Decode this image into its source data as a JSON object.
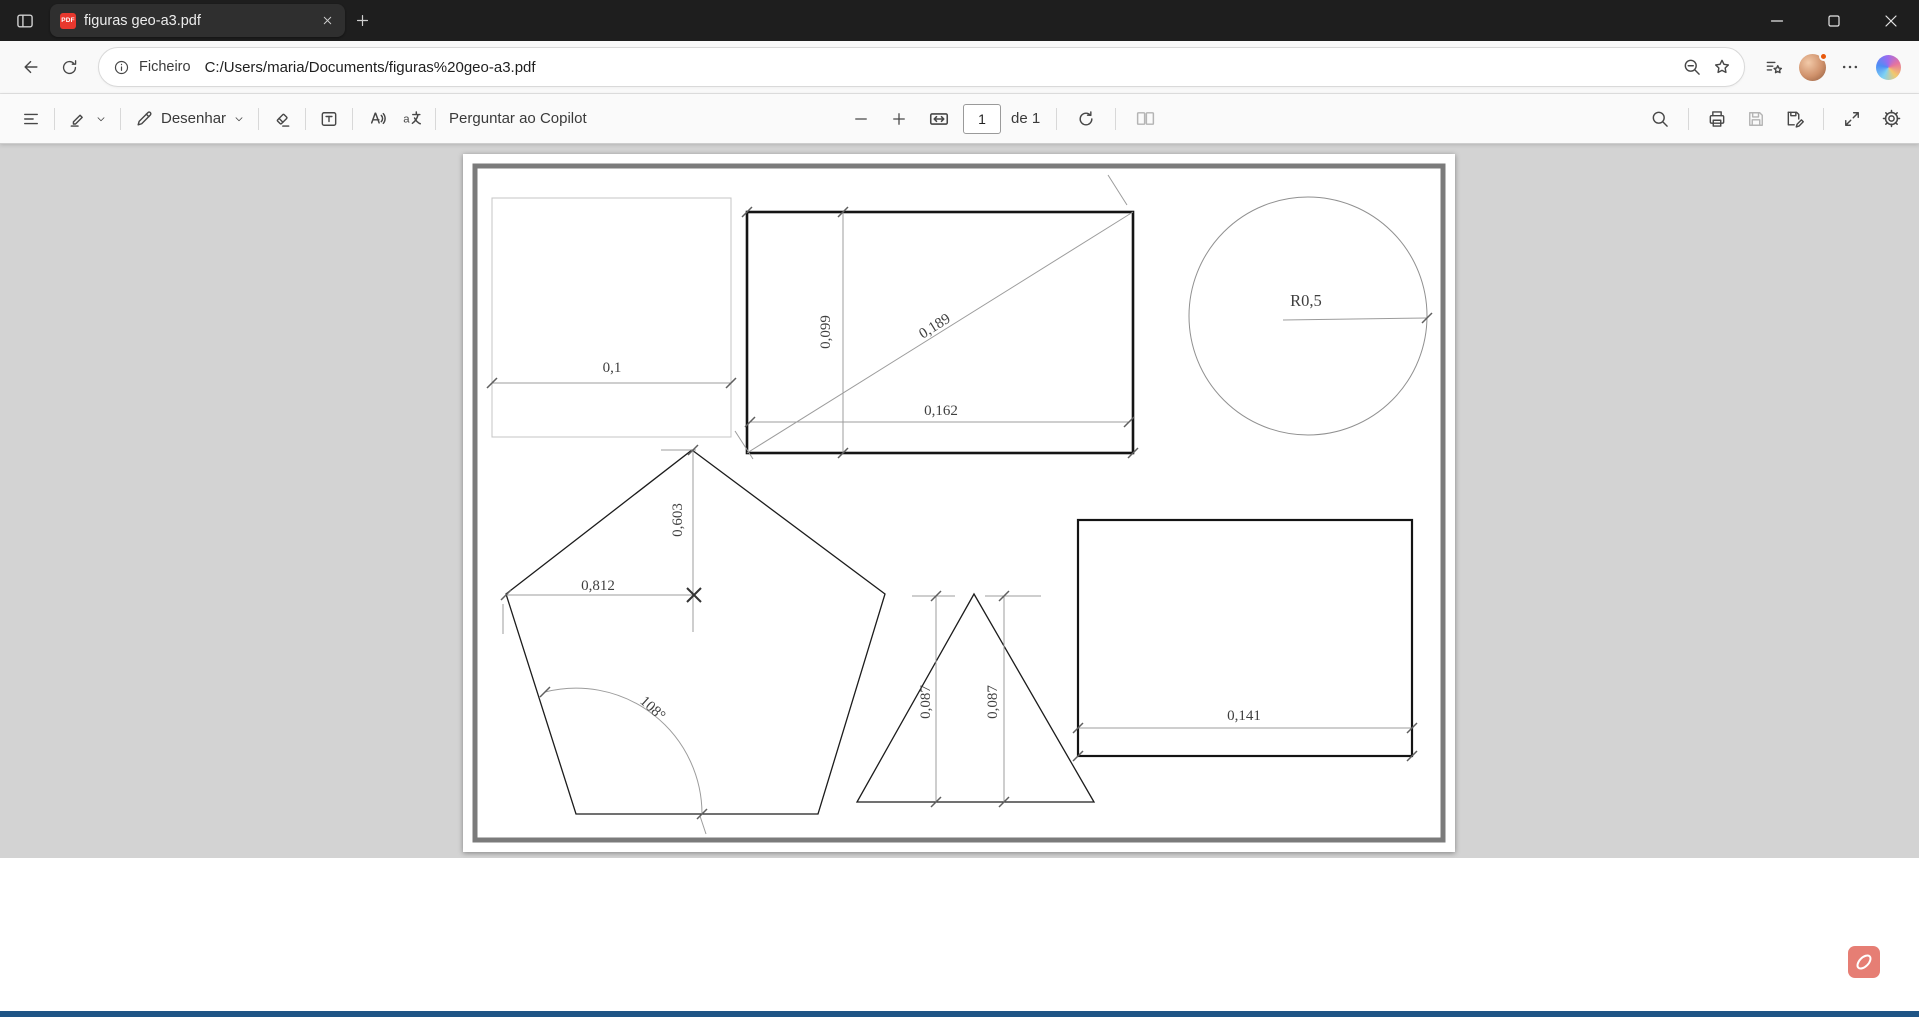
{
  "colors": {
    "titlebar_bg": "#1e1e1e",
    "toolbar_bg": "#f9f9f9",
    "viewer_bg": "#d3d3d3",
    "pdf_badge_red": "#e8382e",
    "acrobat_red": "#dd4c3e",
    "taskbar_edge_blue": "#1f5586"
  },
  "window": {
    "tab": {
      "title": "figuras geo-a3.pdf",
      "badge": "PDF"
    }
  },
  "nav": {
    "file_scheme_label": "Ficheiro",
    "url": "C:/Users/maria/Documents/figuras%20geo-a3.pdf"
  },
  "pdf_toolbar": {
    "draw_label": "Desenhar",
    "ask_copilot_label": "Perguntar ao Copilot",
    "page_value": "1",
    "page_count": "de 1"
  },
  "drawing": {
    "square": {
      "width": "0,1"
    },
    "bold_rect": {
      "height": "0,099",
      "diagonal": "0,189",
      "width": "0,162"
    },
    "circle": {
      "radius": "R0,5"
    },
    "pentagon": {
      "height": "0,603",
      "width": "0,812",
      "angle": "108°"
    },
    "triangle": {
      "left_height": "0,087",
      "right_height": "0,087"
    },
    "plain_rect": {
      "width": "0,141"
    }
  }
}
